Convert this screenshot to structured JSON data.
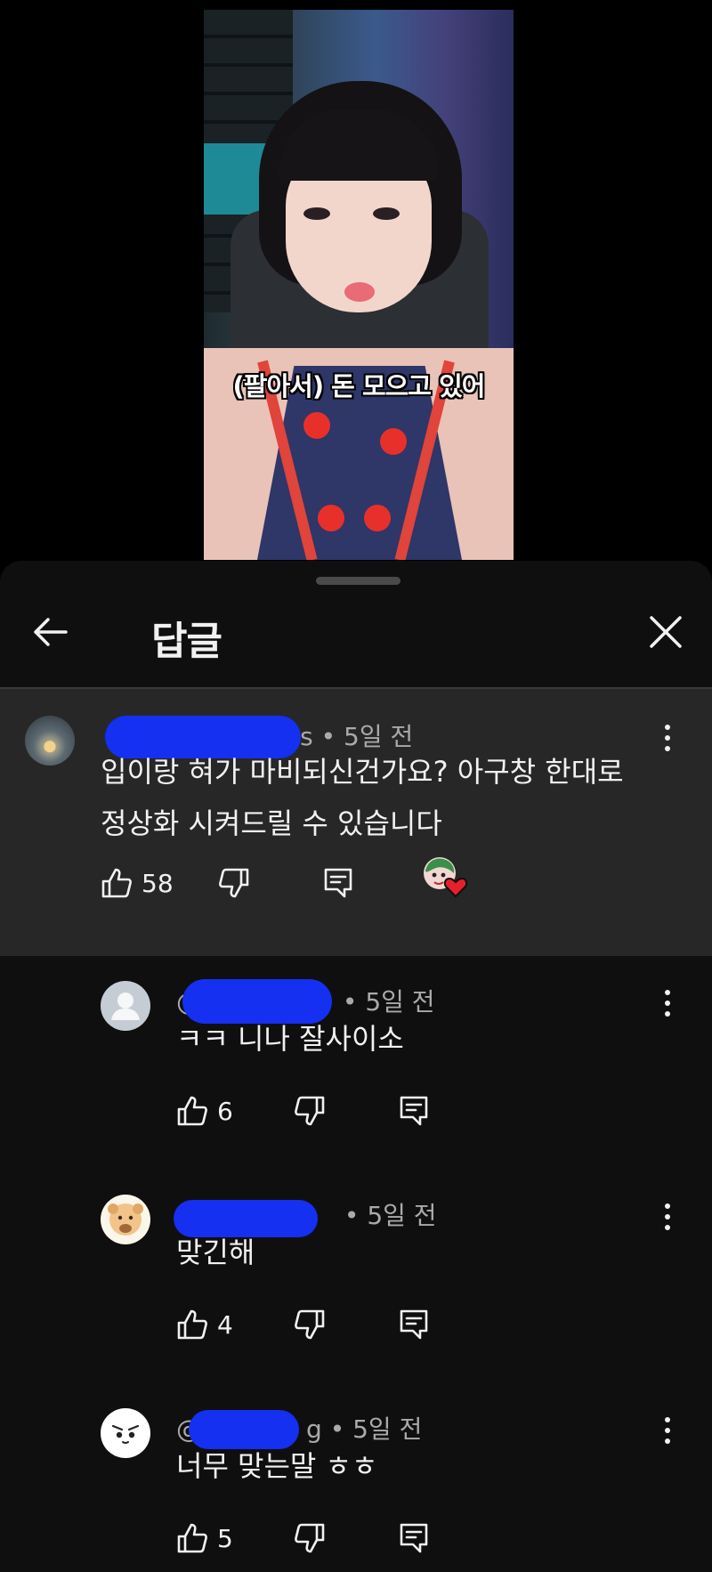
{
  "video": {
    "subtitle": "(팔아서) 돈 모으고 있어"
  },
  "sheet": {
    "title": "답글"
  },
  "parent_comment": {
    "handle_suffix": "-s",
    "time": "• 5일 전",
    "text_line1": "입이랑 혀가 마비되신건가요? 아구창 한대로",
    "text_line2": "정상화 시켜드릴 수 있습니다",
    "likes": "58"
  },
  "replies": [
    {
      "handle_prefix": "@",
      "handle_suffix": "",
      "time": "• 5일 전",
      "text": "ㅋㅋ 니나 잘사이소",
      "likes": "6"
    },
    {
      "handle_prefix": "@",
      "handle_suffix": "",
      "time": "• 5일 전",
      "text": "맞긴해",
      "likes": "4"
    },
    {
      "handle_prefix": "@",
      "handle_suffix": "g",
      "time": "• 5일 전",
      "text": "너무 맞는말 ㅎㅎ",
      "likes": "5"
    }
  ],
  "colors": {
    "background": "#0f0f0f",
    "highlight": "#272727",
    "text": "#f1f1f1",
    "secondary_text": "#aaaaaa",
    "heart": "#e8202a"
  },
  "icons": {
    "back": "arrow-left-icon",
    "close": "close-icon",
    "like": "thumb-up-icon",
    "dislike": "thumb-down-icon",
    "reply": "reply-icon",
    "more": "more-vertical-icon",
    "creator_heart": "creator-heart-icon"
  }
}
